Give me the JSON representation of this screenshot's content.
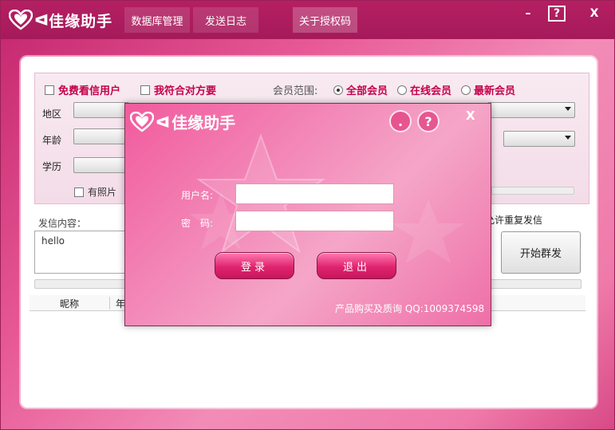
{
  "app": {
    "name": "佳缘助手",
    "wing": "ᐊ",
    "window_controls": {
      "minimize": "–",
      "help": "?",
      "close": "X"
    }
  },
  "topnav": [
    {
      "label": "数据库管理"
    },
    {
      "label": "发送日志"
    },
    {
      "label": "关于授权码"
    }
  ],
  "filters": {
    "free_letter": "免费看信用户",
    "match_me": "我符合对方要",
    "member_range_label": "会员范围:",
    "member_range_options": [
      "全部会员",
      "在线会员",
      "最新会员"
    ],
    "selected_range": "全部会员",
    "labels": {
      "region": "地区",
      "age": "年龄",
      "education": "学历"
    },
    "has_photo": "有照片"
  },
  "message": {
    "label": "发信内容：",
    "content": "hello",
    "allow_repeat": "允许重复发信",
    "start_button": "开始群发"
  },
  "table": {
    "columns": [
      "昵称",
      "年"
    ]
  },
  "login_dialog": {
    "title": "佳缘助手",
    "dot_button": ".",
    "help_button": "?",
    "close_button": "X",
    "username_label": "用户名:",
    "password_label": "密　码:",
    "username_value": "",
    "password_value": "",
    "login_button": "登录",
    "exit_button": "退出",
    "contact": "产品购买及质询 QQ:1009374598"
  }
}
